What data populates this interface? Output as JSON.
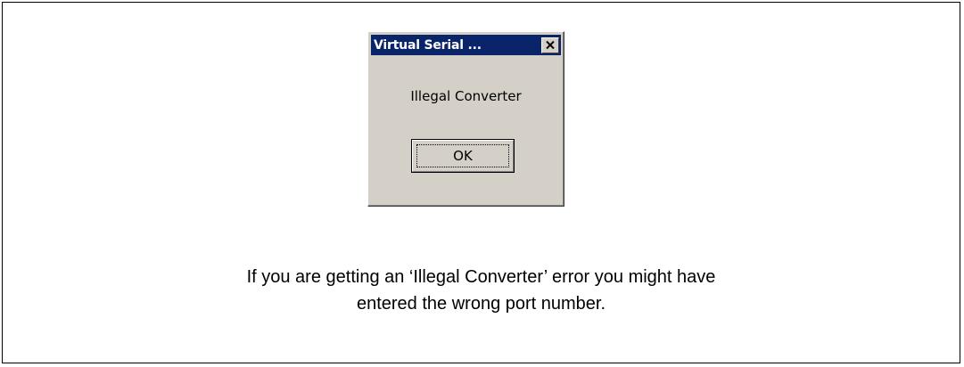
{
  "dialog": {
    "title": "Virtual Serial ...",
    "message": "Illegal Converter",
    "ok_label": "OK",
    "close_icon": "close-icon"
  },
  "caption": {
    "line1": "If you are getting an ‘Illegal Converter’ error you might have",
    "line2": "entered the wrong port number."
  },
  "colors": {
    "titlebar": "#0a246a",
    "dialog_face": "#d4d0c8"
  }
}
